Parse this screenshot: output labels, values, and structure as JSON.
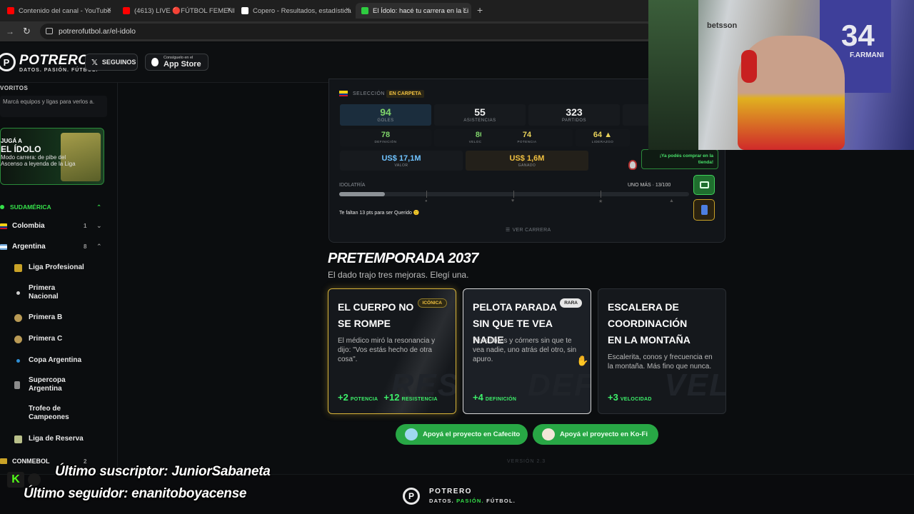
{
  "browser": {
    "tabs": [
      {
        "title": "Contenido del canal - YouTube",
        "favicon_color": "#ff0000"
      },
      {
        "title": "(4613) LIVE 🔴FÚTBOL FEMENI",
        "favicon_color": "#ff0000"
      },
      {
        "title": "Copero - Resultados, estadística",
        "favicon_color": "#ffffff"
      },
      {
        "title": "El Ídolo: hacé tu carrera en la Li",
        "favicon_color": "#2ecc40"
      }
    ],
    "new_tab": "+",
    "url": "potrerofutbol.ar/el-idolo"
  },
  "header": {
    "logo_letter": "P",
    "brand": "POTRERO",
    "tagline": "DATOS. PASIÓN. FÚTBOL.",
    "follow_label": "SEGUINOS",
    "appstore_small": "Consíguelo en el",
    "appstore_label": "App Store"
  },
  "sidebar": {
    "favorites_title": "VORITOS",
    "favorites_hint": "Marcá equipos y ligas para verlos a.",
    "promo": {
      "line1": "JUGÁ A",
      "line2": "EL ÍDOLO",
      "line3": "Modo carrera: de pibe del Ascenso a leyenda de la Liga"
    },
    "region": "SUDAMÉRICA",
    "countries": [
      {
        "name": "Colombia",
        "count": "1",
        "chevron": "⌄"
      },
      {
        "name": "Argentina",
        "count": "8",
        "chevron": "⌃"
      }
    ],
    "leagues": [
      "Liga Profesional",
      "Primera Nacional",
      "Primera B",
      "Primera C",
      "Copa Argentina",
      "Supercopa Argentina",
      "Trofeo de Campeones",
      "Liga de Reserva"
    ],
    "conmebol": {
      "name": "CONMEBOL",
      "count": "2"
    }
  },
  "career": {
    "selection_label": "SELECCIÓN",
    "selection_status": "EN CARPETA",
    "main_stats": [
      {
        "value": "94",
        "label": "GOLES"
      },
      {
        "value": "55",
        "label": "ASISTENCIAS"
      },
      {
        "value": "323",
        "label": "PARTIDOS"
      }
    ],
    "attributes": [
      {
        "value": "78",
        "label": "DEFINICIÓN"
      },
      {
        "value": "80",
        "label": "VELOCIDAD"
      },
      {
        "value": "74",
        "label": "POTENCIA"
      },
      {
        "value": "64 ▲",
        "label": "LIDERAZGO"
      }
    ],
    "value": {
      "amount": "US$ 17,1M",
      "label": "VALOR"
    },
    "earned": {
      "amount": "US$ 1,6M",
      "label": "GANADO"
    },
    "shop_tip": "¡Ya podés comprar en la tienda!",
    "idolatry_label": "IDOLATRÍA",
    "idolatry_status": "UNO MÁS · 13/100",
    "idolatry_progress": 0.13,
    "progress_hint": "Te faltan 13 pts para ser Querido 🙂",
    "view_career": "VER CARRERA"
  },
  "season": {
    "title": "PRETEMPORADA 2037",
    "subtitle": "El dado trajo tres mejoras. Elegí una.",
    "cards": [
      {
        "title": "EL CUERPO NO SE ROMPE",
        "badge": "ICÓNICA",
        "description": "El médico miró la resonancia y dijo: \"Vos estás hecho de otra cosa\".",
        "bonus": [
          {
            "value": "+2",
            "stat": "POTENCIA"
          },
          {
            "value": "+12",
            "stat": "RESISTENCIA"
          }
        ]
      },
      {
        "title": "PELOTA PARADA SIN QUE TE VEA NADIE",
        "badge": "RARA",
        "description": "Tiros libres y córners sin que te vea nadie, uno atrás del otro, sin apuro.",
        "bonus": [
          {
            "value": "+4",
            "stat": "DEFINICIÓN"
          }
        ]
      },
      {
        "title": "ESCALERA DE COORDINACIÓN EN LA MONTAÑA",
        "badge": "",
        "description": "Escalerita, conos y frecuencia en la montaña. Más fino que nunca.",
        "bonus": [
          {
            "value": "+3",
            "stat": "VELOCIDAD"
          }
        ]
      }
    ],
    "donate_cafecito": "Apoyá el proyecto en Cafecito",
    "donate_kofi": "Apoyá el proyecto en Ko-Fi",
    "version": "VERSIÓN 2.3"
  },
  "footer": {
    "brand": "POTRERO",
    "tagline_1": "DATOS.",
    "tagline_2": "PASIÓN.",
    "tagline_3": "FÚTBOL."
  },
  "stream": {
    "kick_logo": "K",
    "last_sub": "Último suscriptor: JuniorSabaneta",
    "last_follower": "Último seguidor: enanitoboyacense",
    "jersey_number": "34",
    "jersey_name": "F.ARMANI",
    "jersey_sponsor": "betsson"
  }
}
